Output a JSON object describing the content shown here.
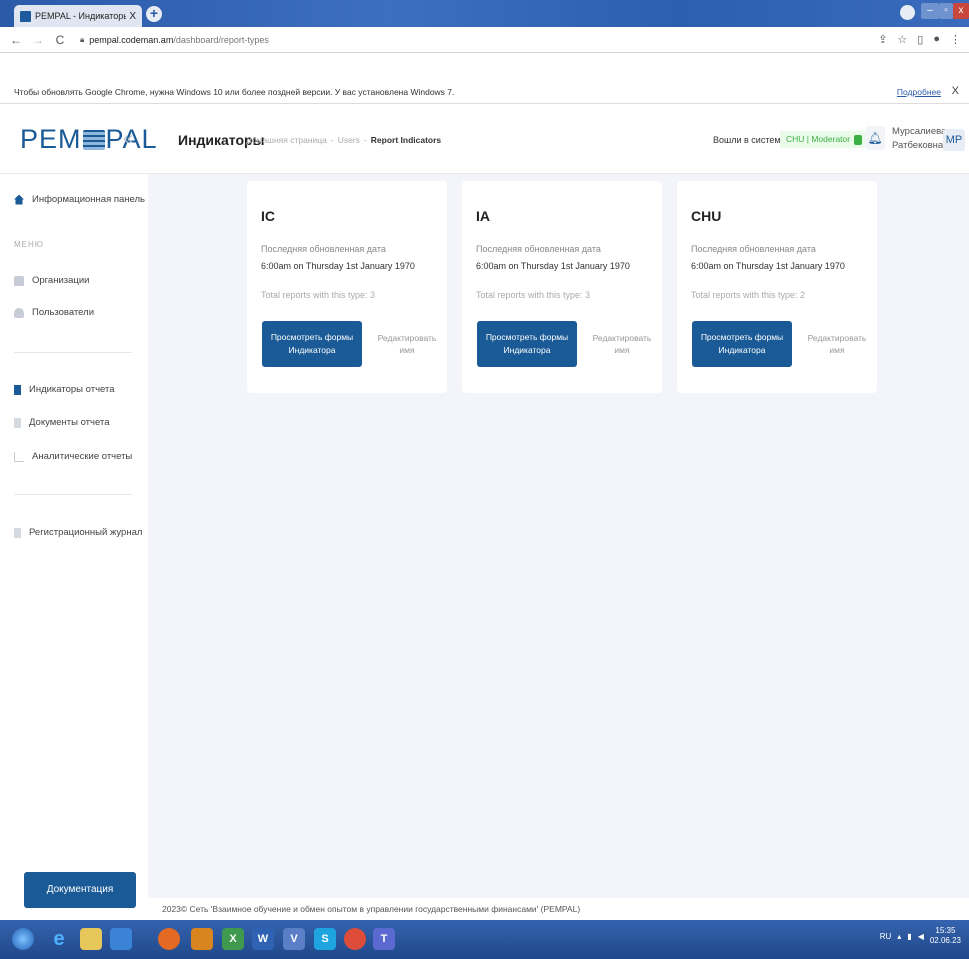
{
  "browser": {
    "tab_title": "PEMPAL - Индикаторы отчета",
    "tab_close": "X",
    "new_tab": "+",
    "profile_icon": "chevron-down-icon",
    "url_host": "pempal.codeman.am",
    "url_path": "/dashboard/report-types",
    "infobar_text": "Чтобы обновлять Google Chrome, нужна Windows 10 или более поздней версии. У вас установлена Windows 7.",
    "infobar_more": "Подробнее",
    "infobar_close": "X"
  },
  "header": {
    "logo_left": "PEM",
    "logo_right": "PAL",
    "collapse": "«",
    "page_title": "Индикаторы",
    "breadcrumbs": [
      "Домашняя страница",
      "-",
      "Users",
      "-",
      "Report Indicators"
    ],
    "logged_in_label": "Вошли в систему как",
    "role": "CHU | Moderator",
    "user_name_line1": "Мурсалиева",
    "user_name_line2": "Ратбековна",
    "avatar": "MP"
  },
  "sidebar": {
    "dashboard": "Информационная панель",
    "menu_label": "МЕНЮ",
    "organizations": "Организации",
    "users": "Пользователи",
    "report_indicators": "Индикаторы отчета",
    "report_documents": "Документы отчета",
    "analytic_reports": "Аналитические отчеты",
    "registration_log": "Регистрационный журнал",
    "docs_button": "Документация"
  },
  "cards": [
    {
      "code": "IC",
      "updated_label": "Последняя обновленная дата",
      "updated_value": "6:00am on Thursday 1st January 1970",
      "total": "Total reports with this type: 3",
      "view_button": "Просмотреть формы Индикатора",
      "edit_link": "Редактировать имя"
    },
    {
      "code": "IA",
      "updated_label": "Последняя обновленная дата",
      "updated_value": "6:00am on Thursday 1st January 1970",
      "total": "Total reports with this type: 3",
      "view_button": "Просмотреть формы Индикатора",
      "edit_link": "Редактировать имя"
    },
    {
      "code": "CHU",
      "updated_label": "Последняя обновленная дата",
      "updated_value": "6:00am on Thursday 1st January 1970",
      "total": "Total reports with this type: 2",
      "view_button": "Просмотреть формы Индикатора",
      "edit_link": "Редактировать имя"
    }
  ],
  "footer": {
    "text": "2023© Сеть 'Взаимное обучение и обмен опытом в управлении государственными финансами' (PEMPAL)"
  },
  "taskbar": {
    "lang": "RU",
    "time": "15:35",
    "date": "02.06.23"
  },
  "colors": {
    "brand": "#1a5a96",
    "role_green": "#3cb045"
  }
}
